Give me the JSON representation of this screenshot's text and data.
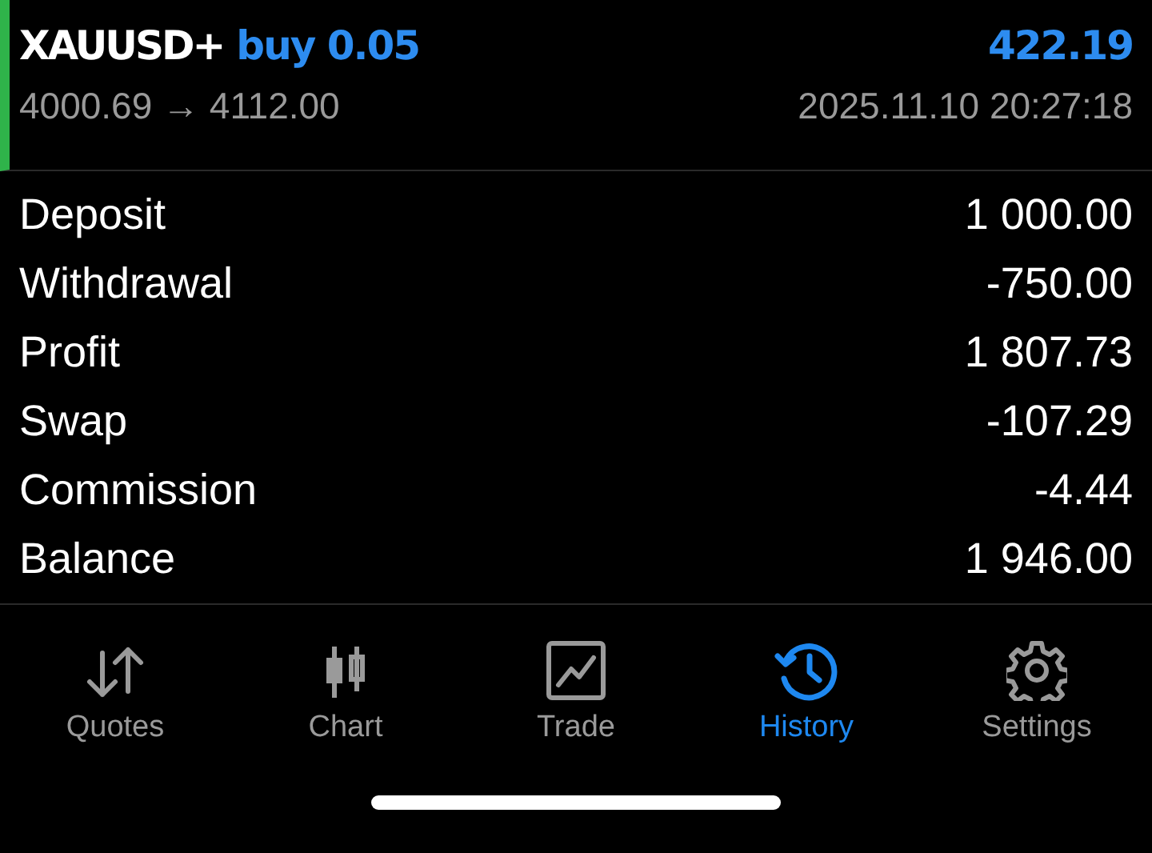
{
  "trade": {
    "symbol": "XAUUSD+",
    "side": "buy 0.05",
    "profit": "422.19",
    "prices": "4000.69 → 4112.00",
    "time": "2025.11.10 20:27:18"
  },
  "summary": [
    {
      "label": "Deposit",
      "value": "1 000.00"
    },
    {
      "label": "Withdrawal",
      "value": "-750.00"
    },
    {
      "label": "Profit",
      "value": "1 807.73"
    },
    {
      "label": "Swap",
      "value": "-107.29"
    },
    {
      "label": "Commission",
      "value": "-4.44"
    },
    {
      "label": "Balance",
      "value": "1 946.00"
    }
  ],
  "tabs": [
    {
      "label": "Quotes",
      "kind": "quotes",
      "selected": false
    },
    {
      "label": "Chart",
      "kind": "chart",
      "selected": false
    },
    {
      "label": "Trade",
      "kind": "trade",
      "selected": false
    },
    {
      "label": "History",
      "kind": "history",
      "selected": true
    },
    {
      "label": "Settings",
      "kind": "settings",
      "selected": false
    }
  ]
}
